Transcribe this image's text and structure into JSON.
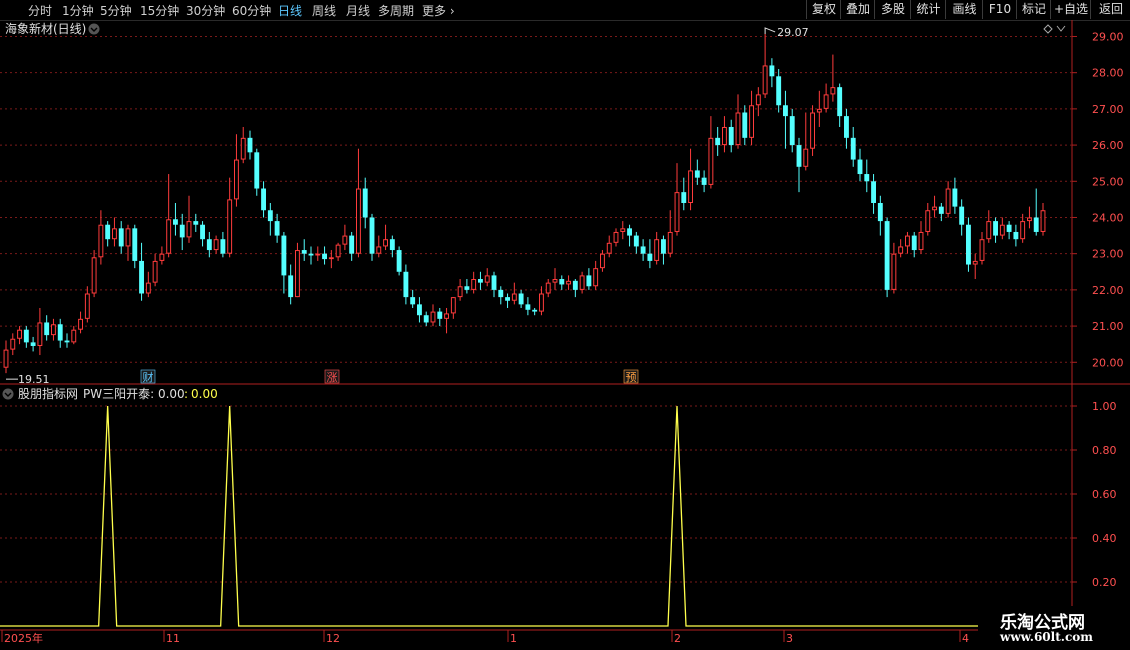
{
  "toolbar": {
    "periods": [
      "分时",
      "1分钟",
      "5分钟",
      "15分钟",
      "30分钟",
      "60分钟",
      "日线",
      "周线",
      "月线",
      "多周期",
      "更多"
    ],
    "active_period": "日线",
    "buttons": [
      "复权",
      "叠加",
      "多股",
      "统计",
      "画线",
      "F10",
      "标记",
      "+自选",
      "返回"
    ]
  },
  "main_panel": {
    "title": "海象新材(日线)",
    "high_label": "29.07",
    "low_label": "19.51",
    "event_markers": [
      "财",
      "涨",
      "预"
    ]
  },
  "indicator_panel": {
    "title": "股朋指标网",
    "indicator_name": "PW三阳开泰",
    "value1": "0.00",
    "value2": "0.00"
  },
  "x_axis": {
    "labels": [
      "2025年",
      "11",
      "12",
      "1",
      "2",
      "3",
      "4"
    ]
  },
  "watermark": {
    "line1": "乐淘公式网",
    "line2": "www.60lt.com"
  },
  "colors": {
    "up": "#ff3c3c",
    "down": "#54ffff",
    "grid": "#7a1a1a",
    "axis": "#b02020",
    "indicator_line": "#ffff4c"
  },
  "chart_data": [
    {
      "type": "candlestick",
      "title": "海象新材(日线)",
      "ylim": [
        19.4,
        29.4
      ],
      "yticks": [
        20.0,
        21.0,
        22.0,
        23.0,
        24.0,
        25.0,
        26.0,
        27.0,
        28.0,
        29.0
      ],
      "x_labels": [
        "2025年",
        "11",
        "12",
        "1",
        "2",
        "3",
        "4"
      ],
      "candles": [
        [
          19.85,
          20.35,
          20.6,
          19.7
        ],
        [
          20.35,
          20.65,
          20.8,
          20.2
        ],
        [
          20.65,
          20.9,
          21.0,
          20.5
        ],
        [
          20.9,
          20.55,
          21.0,
          20.4
        ],
        [
          20.55,
          20.45,
          20.7,
          20.3
        ],
        [
          20.45,
          21.1,
          21.5,
          20.2
        ],
        [
          21.1,
          20.75,
          21.3,
          20.6
        ],
        [
          20.75,
          21.05,
          21.2,
          20.6
        ],
        [
          21.05,
          20.6,
          21.2,
          20.4
        ],
        [
          20.6,
          20.55,
          20.8,
          20.4
        ],
        [
          20.55,
          20.9,
          21.0,
          20.5
        ],
        [
          20.9,
          21.2,
          21.4,
          20.8
        ],
        [
          21.2,
          21.9,
          22.1,
          21.1
        ],
        [
          21.9,
          22.9,
          23.1,
          21.8
        ],
        [
          22.9,
          23.8,
          24.2,
          22.7
        ],
        [
          23.8,
          23.4,
          23.9,
          23.2
        ],
        [
          23.4,
          23.7,
          24.0,
          23.2
        ],
        [
          23.7,
          23.2,
          23.9,
          23.0
        ],
        [
          23.2,
          23.7,
          23.8,
          22.8
        ],
        [
          23.7,
          22.8,
          23.8,
          22.6
        ],
        [
          22.8,
          21.9,
          23.3,
          21.7
        ],
        [
          21.9,
          22.2,
          22.5,
          21.8
        ],
        [
          22.2,
          22.8,
          23.0,
          22.1
        ],
        [
          22.8,
          23.0,
          23.2,
          22.7
        ],
        [
          23.0,
          23.95,
          25.2,
          22.9
        ],
        [
          23.95,
          23.8,
          24.4,
          23.5
        ],
        [
          23.8,
          23.45,
          24.1,
          23.1
        ],
        [
          23.45,
          23.9,
          24.6,
          23.3
        ],
        [
          23.9,
          23.8,
          24.1,
          23.6
        ],
        [
          23.8,
          23.4,
          23.9,
          23.2
        ],
        [
          23.4,
          23.1,
          23.6,
          22.9
        ],
        [
          23.1,
          23.4,
          23.5,
          23.0
        ],
        [
          23.4,
          23.0,
          23.6,
          22.9
        ],
        [
          23.0,
          24.5,
          25.1,
          22.9
        ],
        [
          24.5,
          25.6,
          26.3,
          24.3
        ],
        [
          25.6,
          26.2,
          26.5,
          25.5
        ],
        [
          26.2,
          25.8,
          26.4,
          25.6
        ],
        [
          25.8,
          24.8,
          25.9,
          24.6
        ],
        [
          24.8,
          24.2,
          25.0,
          24.0
        ],
        [
          24.2,
          23.9,
          24.4,
          23.5
        ],
        [
          23.9,
          23.5,
          24.1,
          23.3
        ],
        [
          23.5,
          22.4,
          23.6,
          21.9
        ],
        [
          22.4,
          21.8,
          22.7,
          21.6
        ],
        [
          21.8,
          23.1,
          23.3,
          21.8
        ],
        [
          23.1,
          23.0,
          23.4,
          22.8
        ],
        [
          23.0,
          22.95,
          23.2,
          22.7
        ],
        [
          22.95,
          23.0,
          23.2,
          22.8
        ],
        [
          23.0,
          22.85,
          23.2,
          22.7
        ],
        [
          22.85,
          22.9,
          23.1,
          22.6
        ],
        [
          22.9,
          23.25,
          23.3,
          22.8
        ],
        [
          23.25,
          23.5,
          23.8,
          23.1
        ],
        [
          23.5,
          23.0,
          23.6,
          22.8
        ],
        [
          23.0,
          24.8,
          25.9,
          22.9
        ],
        [
          24.8,
          24.0,
          25.1,
          23.7
        ],
        [
          24.0,
          23.0,
          24.1,
          22.8
        ],
        [
          23.0,
          23.2,
          23.5,
          22.9
        ],
        [
          23.2,
          23.4,
          23.8,
          23.1
        ],
        [
          23.4,
          23.1,
          23.5,
          22.9
        ],
        [
          23.1,
          22.5,
          23.2,
          22.4
        ],
        [
          22.5,
          21.8,
          22.7,
          21.6
        ],
        [
          21.8,
          21.6,
          22.0,
          21.5
        ],
        [
          21.6,
          21.3,
          21.8,
          21.1
        ],
        [
          21.3,
          21.1,
          21.4,
          21.0
        ],
        [
          21.1,
          21.4,
          21.6,
          21.0
        ],
        [
          21.4,
          21.2,
          21.5,
          21.0
        ],
        [
          21.2,
          21.35,
          21.5,
          20.8
        ],
        [
          21.35,
          21.8,
          21.8,
          21.2
        ],
        [
          21.8,
          22.1,
          22.3,
          21.7
        ],
        [
          22.1,
          22.0,
          22.3,
          21.9
        ],
        [
          22.0,
          22.3,
          22.5,
          21.9
        ],
        [
          22.3,
          22.2,
          22.5,
          22.0
        ],
        [
          22.2,
          22.4,
          22.6,
          22.1
        ],
        [
          22.4,
          22.0,
          22.5,
          21.8
        ],
        [
          22.0,
          21.8,
          22.1,
          21.6
        ],
        [
          21.8,
          21.7,
          21.9,
          21.5
        ],
        [
          21.7,
          21.9,
          22.2,
          21.6
        ],
        [
          21.9,
          21.6,
          22.0,
          21.5
        ],
        [
          21.6,
          21.45,
          21.8,
          21.3
        ],
        [
          21.45,
          21.4,
          21.5,
          21.3
        ],
        [
          21.4,
          21.9,
          22.1,
          21.3
        ],
        [
          21.9,
          22.2,
          22.3,
          21.8
        ],
        [
          22.2,
          22.3,
          22.6,
          22.0
        ],
        [
          22.3,
          22.15,
          22.4,
          22.0
        ],
        [
          22.15,
          22.25,
          22.4,
          22.0
        ],
        [
          22.25,
          22.0,
          22.3,
          21.8
        ],
        [
          22.0,
          22.4,
          22.5,
          21.9
        ],
        [
          22.4,
          22.1,
          22.6,
          22.0
        ],
        [
          22.1,
          22.6,
          22.8,
          22.0
        ],
        [
          22.6,
          23.0,
          23.1,
          22.5
        ],
        [
          23.0,
          23.3,
          23.5,
          22.9
        ],
        [
          23.3,
          23.6,
          23.7,
          23.2
        ],
        [
          23.6,
          23.7,
          23.9,
          23.4
        ],
        [
          23.7,
          23.5,
          23.8,
          23.2
        ],
        [
          23.5,
          23.2,
          23.6,
          23.0
        ],
        [
          23.2,
          23.0,
          23.4,
          22.8
        ],
        [
          23.0,
          22.8,
          23.4,
          22.6
        ],
        [
          22.8,
          23.4,
          23.6,
          22.7
        ],
        [
          23.4,
          23.0,
          23.5,
          22.7
        ],
        [
          23.0,
          23.6,
          24.2,
          22.9
        ],
        [
          23.6,
          24.7,
          25.5,
          23.5
        ],
        [
          24.7,
          24.4,
          25.1,
          24.2
        ],
        [
          24.4,
          25.3,
          25.9,
          24.2
        ],
        [
          25.3,
          25.1,
          25.6,
          24.9
        ],
        [
          25.1,
          24.9,
          25.3,
          24.7
        ],
        [
          24.9,
          26.2,
          26.8,
          24.8
        ],
        [
          26.2,
          26.0,
          26.5,
          25.7
        ],
        [
          26.0,
          26.5,
          26.8,
          25.8
        ],
        [
          26.5,
          26.0,
          26.7,
          25.8
        ],
        [
          26.0,
          26.9,
          27.4,
          25.9
        ],
        [
          26.9,
          26.2,
          27.1,
          26.0
        ],
        [
          26.2,
          27.1,
          27.5,
          26.0
        ],
        [
          27.1,
          27.4,
          27.6,
          26.8
        ],
        [
          27.4,
          28.2,
          29.07,
          27.3
        ],
        [
          28.2,
          27.9,
          28.4,
          27.6
        ],
        [
          27.9,
          27.1,
          28.1,
          26.9
        ],
        [
          27.1,
          26.8,
          27.5,
          25.9
        ],
        [
          26.8,
          26.0,
          27.0,
          25.8
        ],
        [
          26.0,
          25.4,
          26.2,
          24.7
        ],
        [
          25.4,
          25.9,
          26.9,
          25.3
        ],
        [
          25.9,
          26.9,
          27.1,
          25.7
        ],
        [
          26.9,
          27.0,
          27.5,
          26.5
        ],
        [
          27.0,
          27.4,
          27.7,
          26.9
        ],
        [
          27.4,
          27.6,
          28.5,
          27.2
        ],
        [
          27.6,
          26.8,
          27.7,
          26.5
        ],
        [
          26.8,
          26.2,
          27.0,
          25.9
        ],
        [
          26.2,
          25.6,
          26.5,
          25.4
        ],
        [
          25.6,
          25.2,
          25.9,
          25.0
        ],
        [
          25.2,
          25.0,
          25.6,
          24.7
        ],
        [
          25.0,
          24.4,
          25.2,
          24.1
        ],
        [
          24.4,
          23.9,
          24.6,
          23.5
        ],
        [
          23.9,
          22.0,
          24.0,
          21.8
        ],
        [
          22.0,
          23.0,
          23.3,
          21.9
        ],
        [
          23.0,
          23.2,
          23.4,
          22.9
        ],
        [
          23.2,
          23.5,
          23.6,
          23.0
        ],
        [
          23.5,
          23.1,
          23.6,
          22.9
        ],
        [
          23.1,
          23.6,
          23.9,
          23.0
        ],
        [
          23.6,
          24.2,
          24.4,
          23.5
        ],
        [
          24.2,
          24.3,
          24.6,
          24.0
        ],
        [
          24.3,
          24.1,
          24.4,
          23.9
        ],
        [
          24.1,
          24.8,
          25.0,
          24.0
        ],
        [
          24.8,
          24.3,
          25.1,
          24.1
        ],
        [
          24.3,
          23.8,
          24.5,
          23.5
        ],
        [
          23.8,
          22.7,
          24.0,
          22.5
        ],
        [
          22.7,
          22.8,
          23.0,
          22.3
        ],
        [
          22.8,
          23.4,
          23.6,
          22.7
        ],
        [
          23.4,
          23.9,
          24.2,
          23.3
        ],
        [
          23.9,
          23.5,
          24.0,
          23.3
        ],
        [
          23.5,
          23.8,
          24.0,
          23.4
        ],
        [
          23.8,
          23.6,
          23.9,
          23.4
        ],
        [
          23.6,
          23.4,
          23.8,
          23.2
        ],
        [
          23.4,
          23.9,
          24.1,
          23.3
        ],
        [
          23.9,
          24.0,
          24.3,
          23.7
        ],
        [
          24.0,
          23.6,
          24.8,
          23.5
        ],
        [
          23.6,
          24.2,
          24.4,
          23.5
        ]
      ],
      "signals": [
        15,
        33,
        99
      ]
    },
    {
      "type": "line",
      "series": [
        {
          "name": "PW三阳开泰",
          "spikes_at": [
            15,
            33,
            99
          ],
          "spike_value": 1.0
        }
      ],
      "ylim": [
        0,
        1.05
      ],
      "yticks": [
        0.2,
        0.4,
        0.6,
        0.8,
        1.0
      ]
    }
  ]
}
